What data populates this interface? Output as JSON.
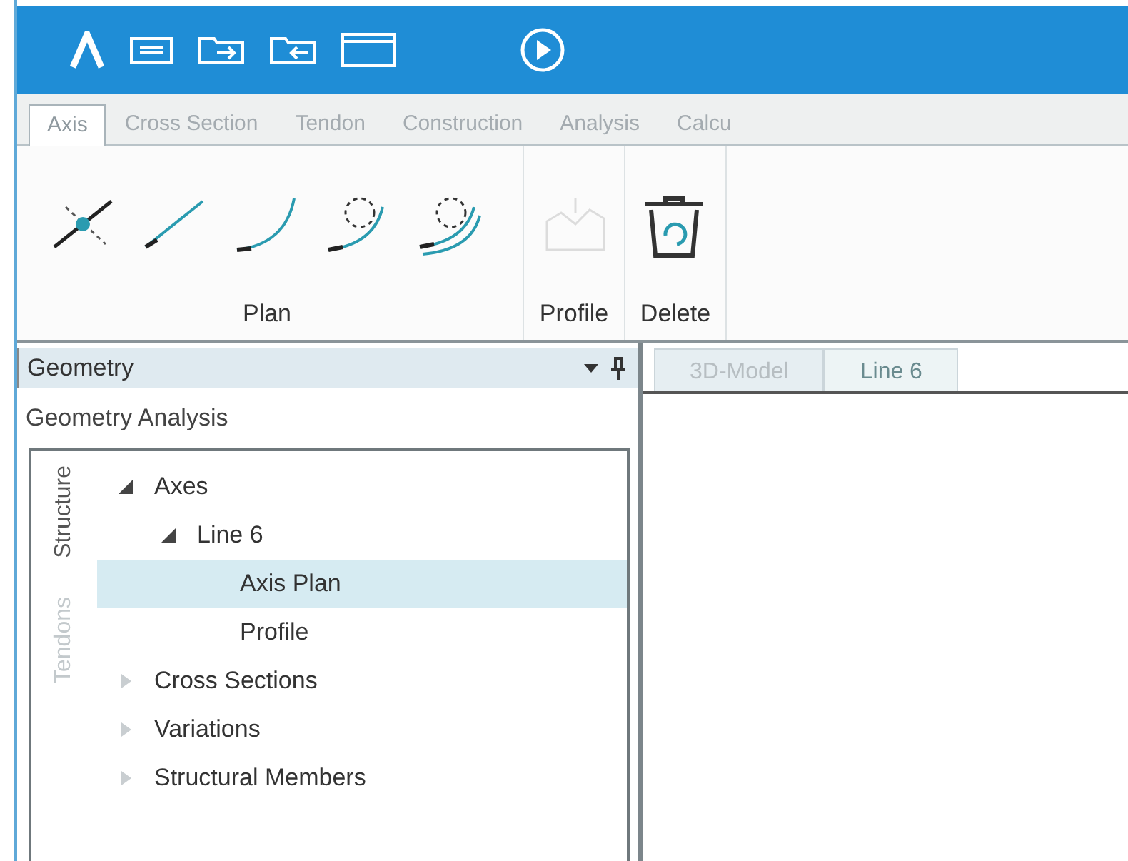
{
  "ribbon": {
    "tabs": [
      {
        "label": "Axis",
        "selected": true
      },
      {
        "label": "Cross Section",
        "selected": false
      },
      {
        "label": "Tendon",
        "selected": false
      },
      {
        "label": "Construction",
        "selected": false
      },
      {
        "label": "Analysis",
        "selected": false
      },
      {
        "label": "Calcu",
        "selected": false
      }
    ],
    "groups": [
      {
        "label": "Plan",
        "tools": [
          {
            "kind": "point",
            "disabled": false
          },
          {
            "kind": "line",
            "disabled": false
          },
          {
            "kind": "arc",
            "disabled": false
          },
          {
            "kind": "circle-arc",
            "disabled": false
          },
          {
            "kind": "double-arc",
            "disabled": false
          }
        ]
      },
      {
        "label": "Profile",
        "tools": [
          {
            "kind": "profile",
            "disabled": true
          }
        ]
      },
      {
        "label": "Delete",
        "tools": [
          {
            "kind": "trash",
            "disabled": false
          }
        ]
      }
    ]
  },
  "panel": {
    "title": "Geometry",
    "subtitle": "Geometry Analysis",
    "side_tabs": [
      {
        "label": "Structure",
        "selected": true
      },
      {
        "label": "Tendons",
        "selected": false
      }
    ],
    "tree": [
      {
        "label": "Axes",
        "expanded": true,
        "selected": false,
        "children": [
          {
            "label": "Line 6",
            "expanded": true,
            "selected": false,
            "children": [
              {
                "label": "Axis Plan",
                "selected": true
              },
              {
                "label": "Profile",
                "selected": false
              }
            ]
          }
        ]
      },
      {
        "label": "Cross Sections",
        "expanded": false,
        "selected": false
      },
      {
        "label": "Variations",
        "expanded": false,
        "selected": false
      },
      {
        "label": "Structural Members",
        "expanded": false,
        "selected": false
      }
    ]
  },
  "document_tabs": [
    {
      "label": "3D-Model",
      "selected": false
    },
    {
      "label": "Line 6",
      "selected": true
    }
  ]
}
